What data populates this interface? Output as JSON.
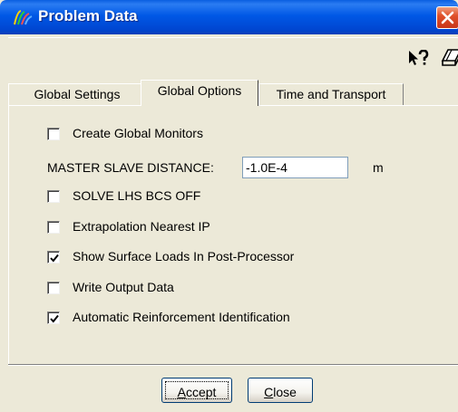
{
  "window": {
    "title": "Problem Data",
    "icons": {
      "app": "app-logo-icon",
      "close": "close-icon"
    }
  },
  "helpbar": {
    "icons": [
      "whats-this-help-icon",
      "eraser-icon"
    ]
  },
  "tabs": [
    {
      "label": "Global Settings",
      "active": false
    },
    {
      "label": "Global Options",
      "active": true
    },
    {
      "label": "Time and Transport",
      "active": false
    }
  ],
  "options": {
    "create_global_monitors": {
      "label": "Create Global Monitors",
      "checked": false
    },
    "master_slave_distance": {
      "label": "MASTER SLAVE DISTANCE:",
      "value": "-1.0E-4",
      "unit": "m"
    },
    "solve_lhs_bcs_off": {
      "label": "SOLVE LHS BCS OFF",
      "checked": false
    },
    "extrapolation_nearest_ip": {
      "label": "Extrapolation Nearest IP",
      "checked": false
    },
    "show_surface_loads": {
      "label": "Show Surface Loads In Post-Processor",
      "checked": true
    },
    "write_output_data": {
      "label": "Write Output Data",
      "checked": false
    },
    "auto_reinforcement_id": {
      "label": "Automatic Reinforcement Identification",
      "checked": true
    }
  },
  "buttons": {
    "accept": {
      "mnemonic": "A",
      "rest": "ccept"
    },
    "close": {
      "mnemonic": "C",
      "rest": "lose"
    }
  },
  "colors": {
    "titlebar": "#0058e6",
    "dialog_bg": "#ece9d8",
    "close_button": "#e0502a",
    "input_border": "#7f9db9",
    "check_mark": "#000000"
  }
}
